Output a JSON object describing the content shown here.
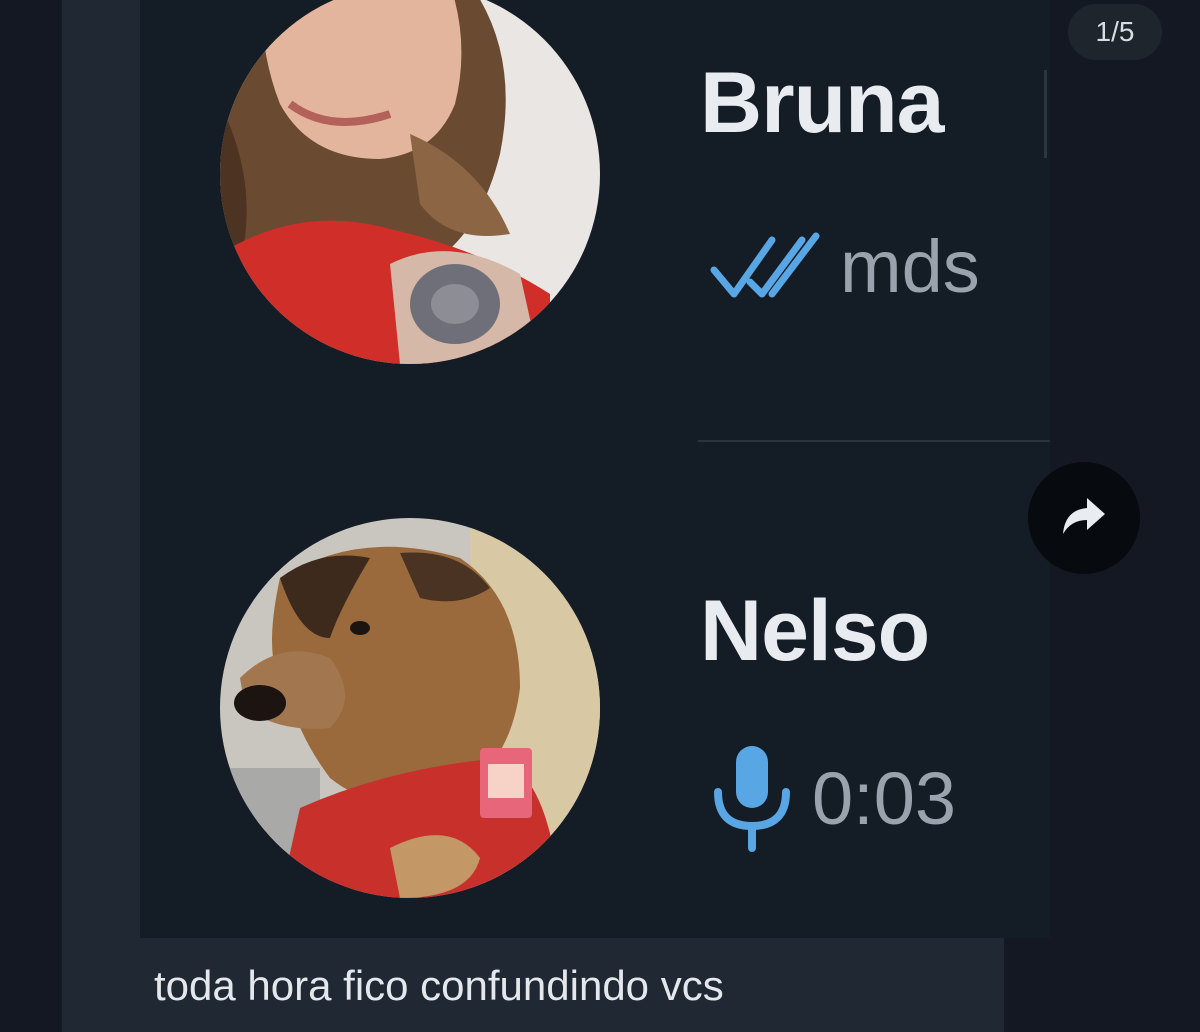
{
  "page_counter": "1/5",
  "conversations": [
    {
      "name": "Bruna",
      "status_icon": "double-check-icon",
      "last_message": "mds",
      "avatar": "woman-photo"
    },
    {
      "name": "Nelso",
      "status_icon": "microphone-icon",
      "last_message": "0:03",
      "avatar": "dog-photo"
    }
  ],
  "caption": "toda hora fico confundindo vcs",
  "share_icon": "share-arrow-icon",
  "colors": {
    "background": "#131822",
    "chat_background": "#141c25",
    "accent_blue": "#58a6e4",
    "name_text": "#e8ecf0",
    "preview_text": "#9aa3ad"
  }
}
